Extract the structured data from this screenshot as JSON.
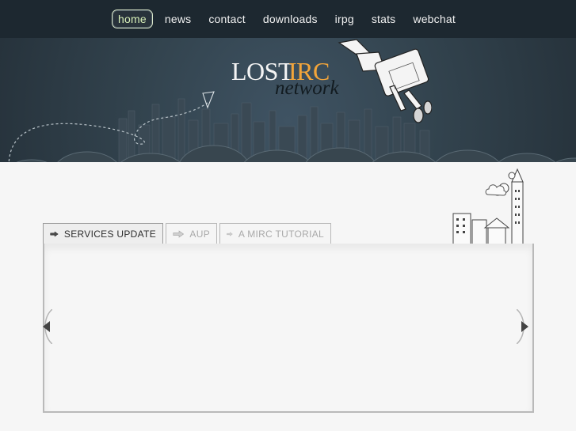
{
  "nav": {
    "items": [
      "home",
      "news",
      "contact",
      "downloads",
      "irpg",
      "stats",
      "webchat"
    ],
    "active": "home"
  },
  "logo": {
    "lost": "LOST",
    "irc": "IRC",
    "network": "network"
  },
  "tabs": [
    {
      "label": "SERVICES UPDATE",
      "active": true
    },
    {
      "label": "AUP",
      "active": false
    },
    {
      "label": "A MIRC TUTORIAL",
      "active": false
    }
  ],
  "slider": {
    "prev_icon": "arrow-left-icon",
    "next_icon": "arrow-right-icon"
  },
  "colors": {
    "background": "#2b3a46",
    "accent_orange": "#f3a53a",
    "active_nav": "#d8f0b8",
    "paper": "#f6f6f6"
  }
}
